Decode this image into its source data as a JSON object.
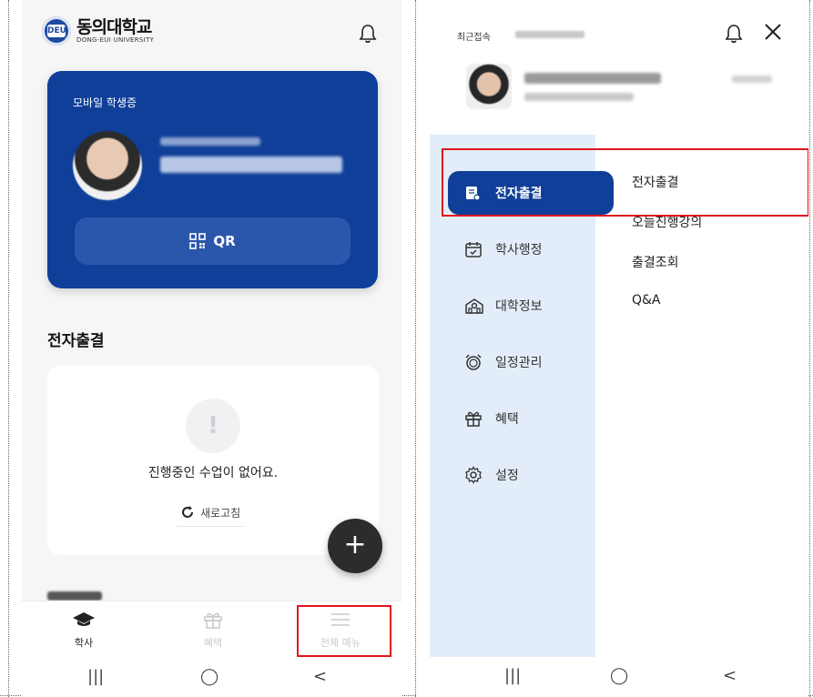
{
  "left": {
    "logo": {
      "name_kr": "동의대학교",
      "name_en": "DONG-EUI UNIVERSITY",
      "seal_text": "DEU"
    },
    "card": {
      "title": "모바일 학생증",
      "qr_label": "QR"
    },
    "section": {
      "title": "전자출결"
    },
    "empty": {
      "icon": "!",
      "message": "진행중인 수업이 없어요.",
      "refresh_label": "새로고침"
    },
    "fab_label": "+",
    "bottom_nav": [
      {
        "label": "학사",
        "icon": "graduation-cap-icon"
      },
      {
        "label": "혜택",
        "icon": "gift-icon"
      },
      {
        "label": "전체 메뉴",
        "icon": "hamburger-icon"
      }
    ]
  },
  "right": {
    "recent_label": "최근접속",
    "main_menu": [
      {
        "label": "전자출결",
        "icon": "attendance-icon",
        "active": true
      },
      {
        "label": "학사행정",
        "icon": "calendar-icon"
      },
      {
        "label": "대학정보",
        "icon": "building-icon"
      },
      {
        "label": "일정관리",
        "icon": "alarm-clock-icon"
      },
      {
        "label": "혜택",
        "icon": "gift-icon"
      },
      {
        "label": "설정",
        "icon": "gear-icon"
      }
    ],
    "sub_menu": [
      "전자출결",
      "오늘진행강의",
      "출결조회",
      "Q&A"
    ]
  },
  "system_nav": {
    "recents": "|||",
    "home": "◯",
    "back": "<"
  },
  "colors": {
    "primary": "#0f3f99",
    "highlight": "#e0141e",
    "menu_bg": "#e3edf9"
  }
}
